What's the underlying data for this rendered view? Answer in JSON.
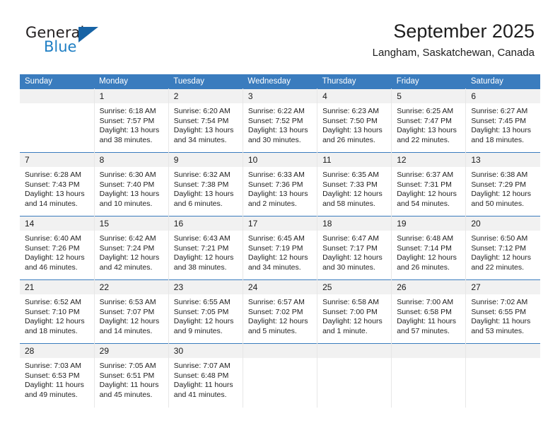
{
  "logo": {
    "word_top": "General",
    "word_bottom": "Blue",
    "accent_color": "#1763a5",
    "blue_text_color": "#1f7fc4"
  },
  "header": {
    "title": "September 2025",
    "subtitle": "Langham, Saskatchewan, Canada"
  },
  "calendar": {
    "header_color": "#3a7cbe",
    "daynum_band_color": "#f1f1f1",
    "weekdays": [
      "Sunday",
      "Monday",
      "Tuesday",
      "Wednesday",
      "Thursday",
      "Friday",
      "Saturday"
    ],
    "weeks": [
      [
        {
          "day": "",
          "sunrise": "",
          "sunset": "",
          "daylight": "",
          "empty": true
        },
        {
          "day": "1",
          "sunrise": "Sunrise: 6:18 AM",
          "sunset": "Sunset: 7:57 PM",
          "daylight": "Daylight: 13 hours and 38 minutes."
        },
        {
          "day": "2",
          "sunrise": "Sunrise: 6:20 AM",
          "sunset": "Sunset: 7:54 PM",
          "daylight": "Daylight: 13 hours and 34 minutes."
        },
        {
          "day": "3",
          "sunrise": "Sunrise: 6:22 AM",
          "sunset": "Sunset: 7:52 PM",
          "daylight": "Daylight: 13 hours and 30 minutes."
        },
        {
          "day": "4",
          "sunrise": "Sunrise: 6:23 AM",
          "sunset": "Sunset: 7:50 PM",
          "daylight": "Daylight: 13 hours and 26 minutes."
        },
        {
          "day": "5",
          "sunrise": "Sunrise: 6:25 AM",
          "sunset": "Sunset: 7:47 PM",
          "daylight": "Daylight: 13 hours and 22 minutes."
        },
        {
          "day": "6",
          "sunrise": "Sunrise: 6:27 AM",
          "sunset": "Sunset: 7:45 PM",
          "daylight": "Daylight: 13 hours and 18 minutes."
        }
      ],
      [
        {
          "day": "7",
          "sunrise": "Sunrise: 6:28 AM",
          "sunset": "Sunset: 7:43 PM",
          "daylight": "Daylight: 13 hours and 14 minutes."
        },
        {
          "day": "8",
          "sunrise": "Sunrise: 6:30 AM",
          "sunset": "Sunset: 7:40 PM",
          "daylight": "Daylight: 13 hours and 10 minutes."
        },
        {
          "day": "9",
          "sunrise": "Sunrise: 6:32 AM",
          "sunset": "Sunset: 7:38 PM",
          "daylight": "Daylight: 13 hours and 6 minutes."
        },
        {
          "day": "10",
          "sunrise": "Sunrise: 6:33 AM",
          "sunset": "Sunset: 7:36 PM",
          "daylight": "Daylight: 13 hours and 2 minutes."
        },
        {
          "day": "11",
          "sunrise": "Sunrise: 6:35 AM",
          "sunset": "Sunset: 7:33 PM",
          "daylight": "Daylight: 12 hours and 58 minutes."
        },
        {
          "day": "12",
          "sunrise": "Sunrise: 6:37 AM",
          "sunset": "Sunset: 7:31 PM",
          "daylight": "Daylight: 12 hours and 54 minutes."
        },
        {
          "day": "13",
          "sunrise": "Sunrise: 6:38 AM",
          "sunset": "Sunset: 7:29 PM",
          "daylight": "Daylight: 12 hours and 50 minutes."
        }
      ],
      [
        {
          "day": "14",
          "sunrise": "Sunrise: 6:40 AM",
          "sunset": "Sunset: 7:26 PM",
          "daylight": "Daylight: 12 hours and 46 minutes."
        },
        {
          "day": "15",
          "sunrise": "Sunrise: 6:42 AM",
          "sunset": "Sunset: 7:24 PM",
          "daylight": "Daylight: 12 hours and 42 minutes."
        },
        {
          "day": "16",
          "sunrise": "Sunrise: 6:43 AM",
          "sunset": "Sunset: 7:21 PM",
          "daylight": "Daylight: 12 hours and 38 minutes."
        },
        {
          "day": "17",
          "sunrise": "Sunrise: 6:45 AM",
          "sunset": "Sunset: 7:19 PM",
          "daylight": "Daylight: 12 hours and 34 minutes."
        },
        {
          "day": "18",
          "sunrise": "Sunrise: 6:47 AM",
          "sunset": "Sunset: 7:17 PM",
          "daylight": "Daylight: 12 hours and 30 minutes."
        },
        {
          "day": "19",
          "sunrise": "Sunrise: 6:48 AM",
          "sunset": "Sunset: 7:14 PM",
          "daylight": "Daylight: 12 hours and 26 minutes."
        },
        {
          "day": "20",
          "sunrise": "Sunrise: 6:50 AM",
          "sunset": "Sunset: 7:12 PM",
          "daylight": "Daylight: 12 hours and 22 minutes."
        }
      ],
      [
        {
          "day": "21",
          "sunrise": "Sunrise: 6:52 AM",
          "sunset": "Sunset: 7:10 PM",
          "daylight": "Daylight: 12 hours and 18 minutes."
        },
        {
          "day": "22",
          "sunrise": "Sunrise: 6:53 AM",
          "sunset": "Sunset: 7:07 PM",
          "daylight": "Daylight: 12 hours and 14 minutes."
        },
        {
          "day": "23",
          "sunrise": "Sunrise: 6:55 AM",
          "sunset": "Sunset: 7:05 PM",
          "daylight": "Daylight: 12 hours and 9 minutes."
        },
        {
          "day": "24",
          "sunrise": "Sunrise: 6:57 AM",
          "sunset": "Sunset: 7:02 PM",
          "daylight": "Daylight: 12 hours and 5 minutes."
        },
        {
          "day": "25",
          "sunrise": "Sunrise: 6:58 AM",
          "sunset": "Sunset: 7:00 PM",
          "daylight": "Daylight: 12 hours and 1 minute."
        },
        {
          "day": "26",
          "sunrise": "Sunrise: 7:00 AM",
          "sunset": "Sunset: 6:58 PM",
          "daylight": "Daylight: 11 hours and 57 minutes."
        },
        {
          "day": "27",
          "sunrise": "Sunrise: 7:02 AM",
          "sunset": "Sunset: 6:55 PM",
          "daylight": "Daylight: 11 hours and 53 minutes."
        }
      ],
      [
        {
          "day": "28",
          "sunrise": "Sunrise: 7:03 AM",
          "sunset": "Sunset: 6:53 PM",
          "daylight": "Daylight: 11 hours and 49 minutes."
        },
        {
          "day": "29",
          "sunrise": "Sunrise: 7:05 AM",
          "sunset": "Sunset: 6:51 PM",
          "daylight": "Daylight: 11 hours and 45 minutes."
        },
        {
          "day": "30",
          "sunrise": "Sunrise: 7:07 AM",
          "sunset": "Sunset: 6:48 PM",
          "daylight": "Daylight: 11 hours and 41 minutes."
        },
        {
          "day": "",
          "sunrise": "",
          "sunset": "",
          "daylight": "",
          "empty": true
        },
        {
          "day": "",
          "sunrise": "",
          "sunset": "",
          "daylight": "",
          "empty": true
        },
        {
          "day": "",
          "sunrise": "",
          "sunset": "",
          "daylight": "",
          "empty": true
        },
        {
          "day": "",
          "sunrise": "",
          "sunset": "",
          "daylight": "",
          "empty": true
        }
      ]
    ]
  }
}
